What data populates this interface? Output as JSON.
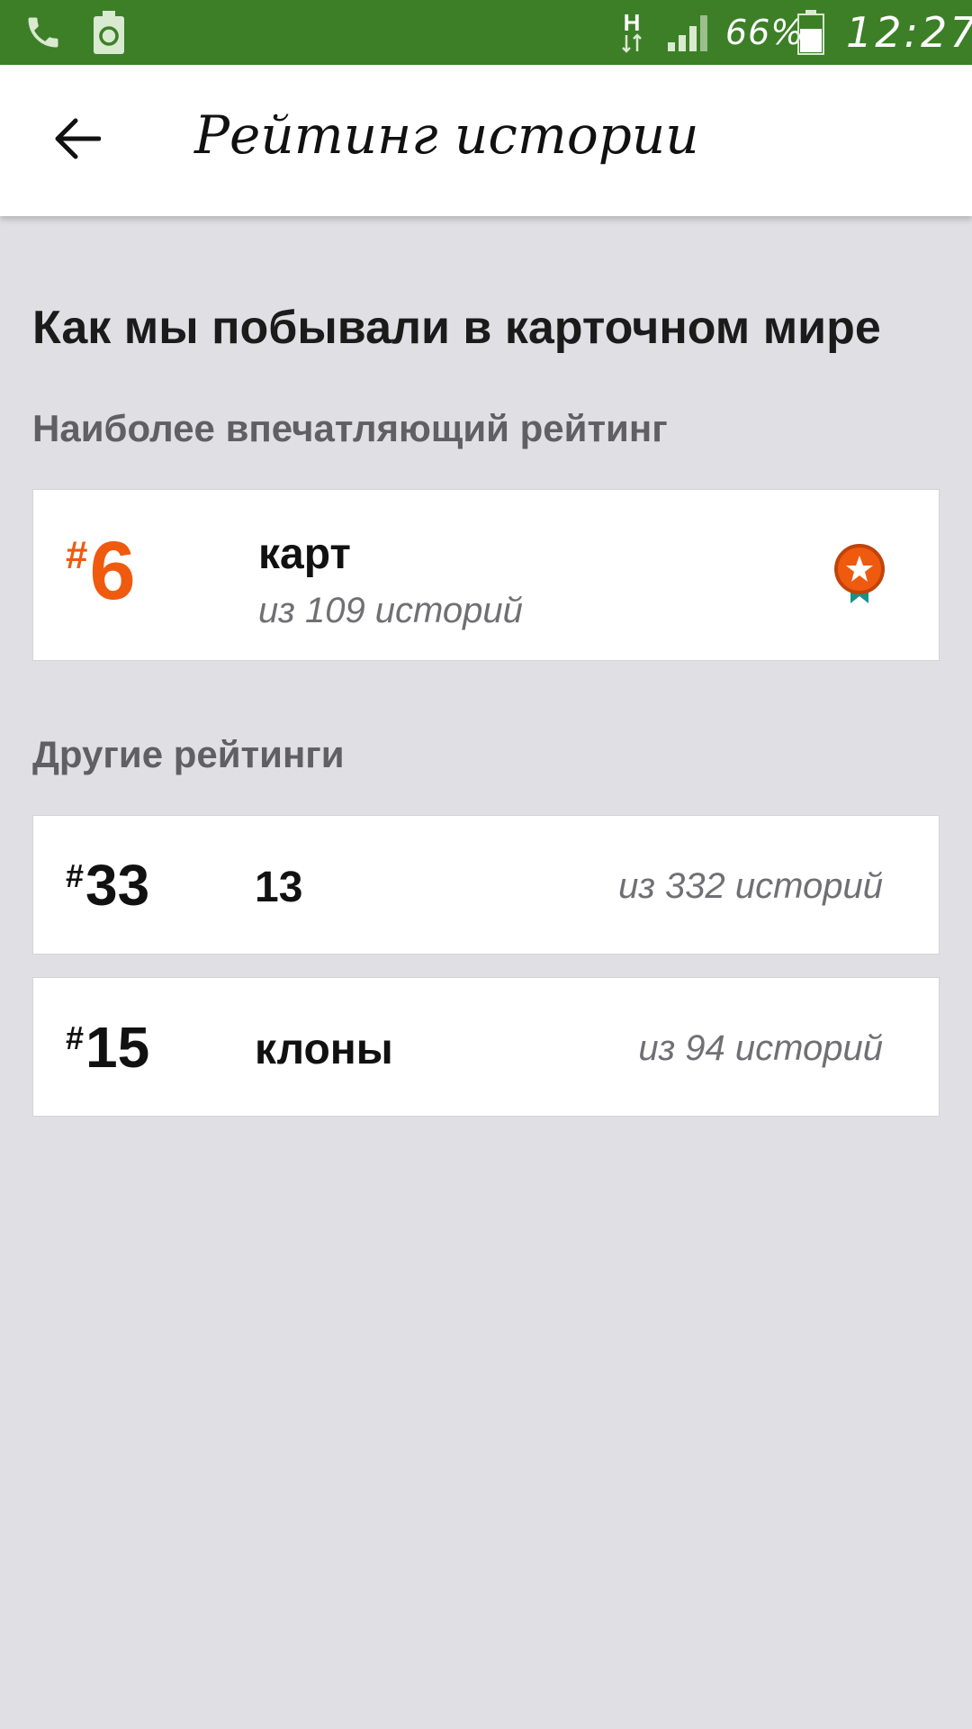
{
  "status_bar": {
    "network_type": "H",
    "battery_percent": "66%",
    "time": "12:27",
    "battery_level": 0.66
  },
  "app_bar": {
    "title": "Рейтинг истории",
    "back_icon": "arrow-left-icon"
  },
  "story": {
    "title": "Как мы побывали в карточном  мире"
  },
  "highlight": {
    "heading": "Наиболее впечатляющий рейтинг",
    "hash": "#",
    "rank": "6",
    "category": "карт",
    "count": "из 109 историй",
    "icon": "medal-icon",
    "accent_color": "#f05a0f",
    "ribbon_color": "#16938d"
  },
  "others": {
    "heading": "Другие рейтинги",
    "items": [
      {
        "hash": "#",
        "rank": "33",
        "category": "13",
        "count": "из 332 историй"
      },
      {
        "hash": "#",
        "rank": "15",
        "category": "клоны",
        "count": "из 94 историй"
      }
    ]
  },
  "colors": {
    "status_bar": "#3c7f27",
    "background": "#e0dfe3"
  }
}
